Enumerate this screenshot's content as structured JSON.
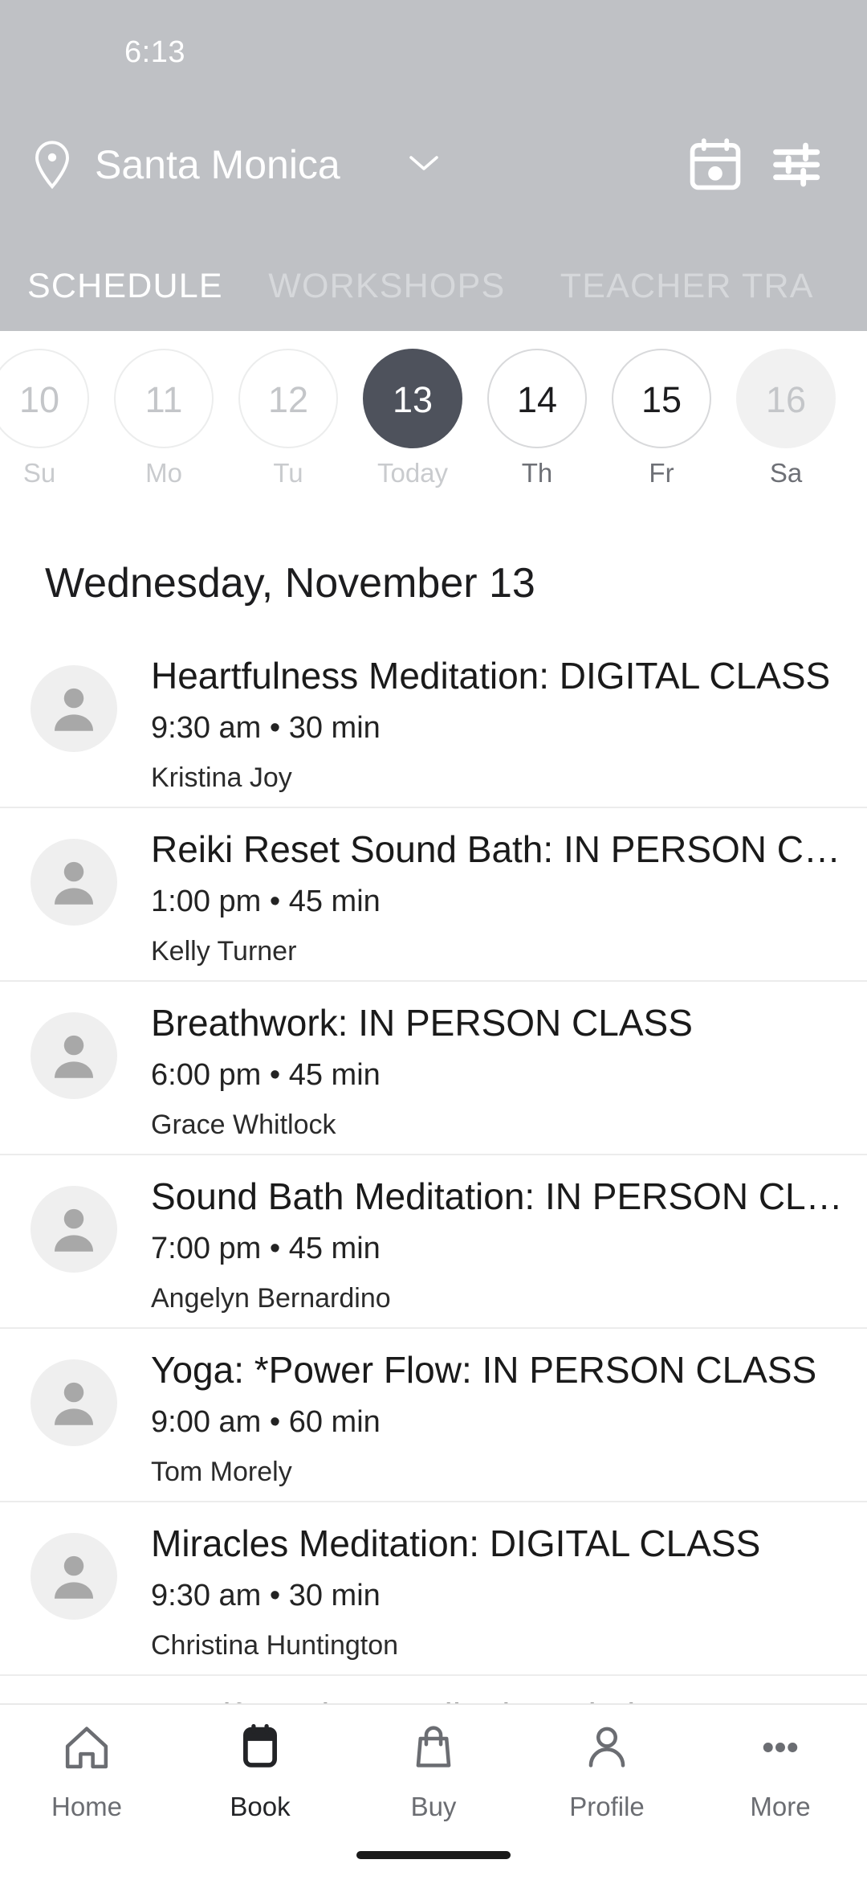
{
  "statusbar": {
    "time": "6:13"
  },
  "header": {
    "location": "Santa Monica",
    "location_icon": "location-pin-icon",
    "chevron_icon": "chevron-down-icon",
    "calendar_icon": "calendar-icon",
    "filter_icon": "filter-sliders-icon",
    "background_color": "#bfc1c5"
  },
  "tabs": [
    {
      "label": "SCHEDULE",
      "active": true
    },
    {
      "label": "WORKSHOPS",
      "active": false
    },
    {
      "label": "TEACHER TRA",
      "active": false
    }
  ],
  "date_strip": [
    {
      "num": "10",
      "label": "Su",
      "state": "disabled"
    },
    {
      "num": "11",
      "label": "Mo",
      "state": "disabled"
    },
    {
      "num": "12",
      "label": "Tu",
      "state": "disabled"
    },
    {
      "num": "13",
      "label": "Today",
      "state": "selected"
    },
    {
      "num": "14",
      "label": "Th",
      "state": "enabled"
    },
    {
      "num": "15",
      "label": "Fr",
      "state": "enabled"
    },
    {
      "num": "16",
      "label": "Sa",
      "state": "shaded"
    }
  ],
  "selected_date_heading": "Wednesday, November 13",
  "classes": [
    {
      "title": "Heartfulness Meditation: DIGITAL CLASS",
      "meta": "9:30 am • 30 min",
      "teacher": "Kristina Joy"
    },
    {
      "title": "Reiki Reset Sound Bath: IN PERSON C…",
      "meta": "1:00 pm • 45 min",
      "teacher": "Kelly Turner"
    },
    {
      "title": "Breathwork: IN PERSON CLASS",
      "meta": "6:00 pm • 45 min",
      "teacher": "Grace Whitlock"
    },
    {
      "title": "Sound Bath Meditation: IN PERSON CL…",
      "meta": "7:00 pm • 45 min",
      "teacher": "Angelyn Bernardino"
    },
    {
      "title": "Yoga: *Power Flow: IN PERSON CLASS",
      "meta": "9:00 am • 60 min",
      "teacher": "Tom Morely"
    },
    {
      "title": "Miracles Meditation: DIGITAL CLASS",
      "meta": "9:30 am • 30 min",
      "teacher": "Christina Huntington"
    },
    {
      "title": "Manifestation Meditation Circle: IN PER",
      "meta": "",
      "teacher": ""
    }
  ],
  "bottom_nav": [
    {
      "label": "Home",
      "icon": "home-icon",
      "active": false
    },
    {
      "label": "Book",
      "icon": "book-calendar-icon",
      "active": true
    },
    {
      "label": "Buy",
      "icon": "shopping-bag-icon",
      "active": false
    },
    {
      "label": "Profile",
      "icon": "person-icon",
      "active": false
    },
    {
      "label": "More",
      "icon": "more-dots-icon",
      "active": false
    }
  ],
  "colors": {
    "selected_day": "#4e525c",
    "header_bg": "#bfc1c5",
    "active_nav": "#232427",
    "inactive_nav": "#6b6d72"
  }
}
